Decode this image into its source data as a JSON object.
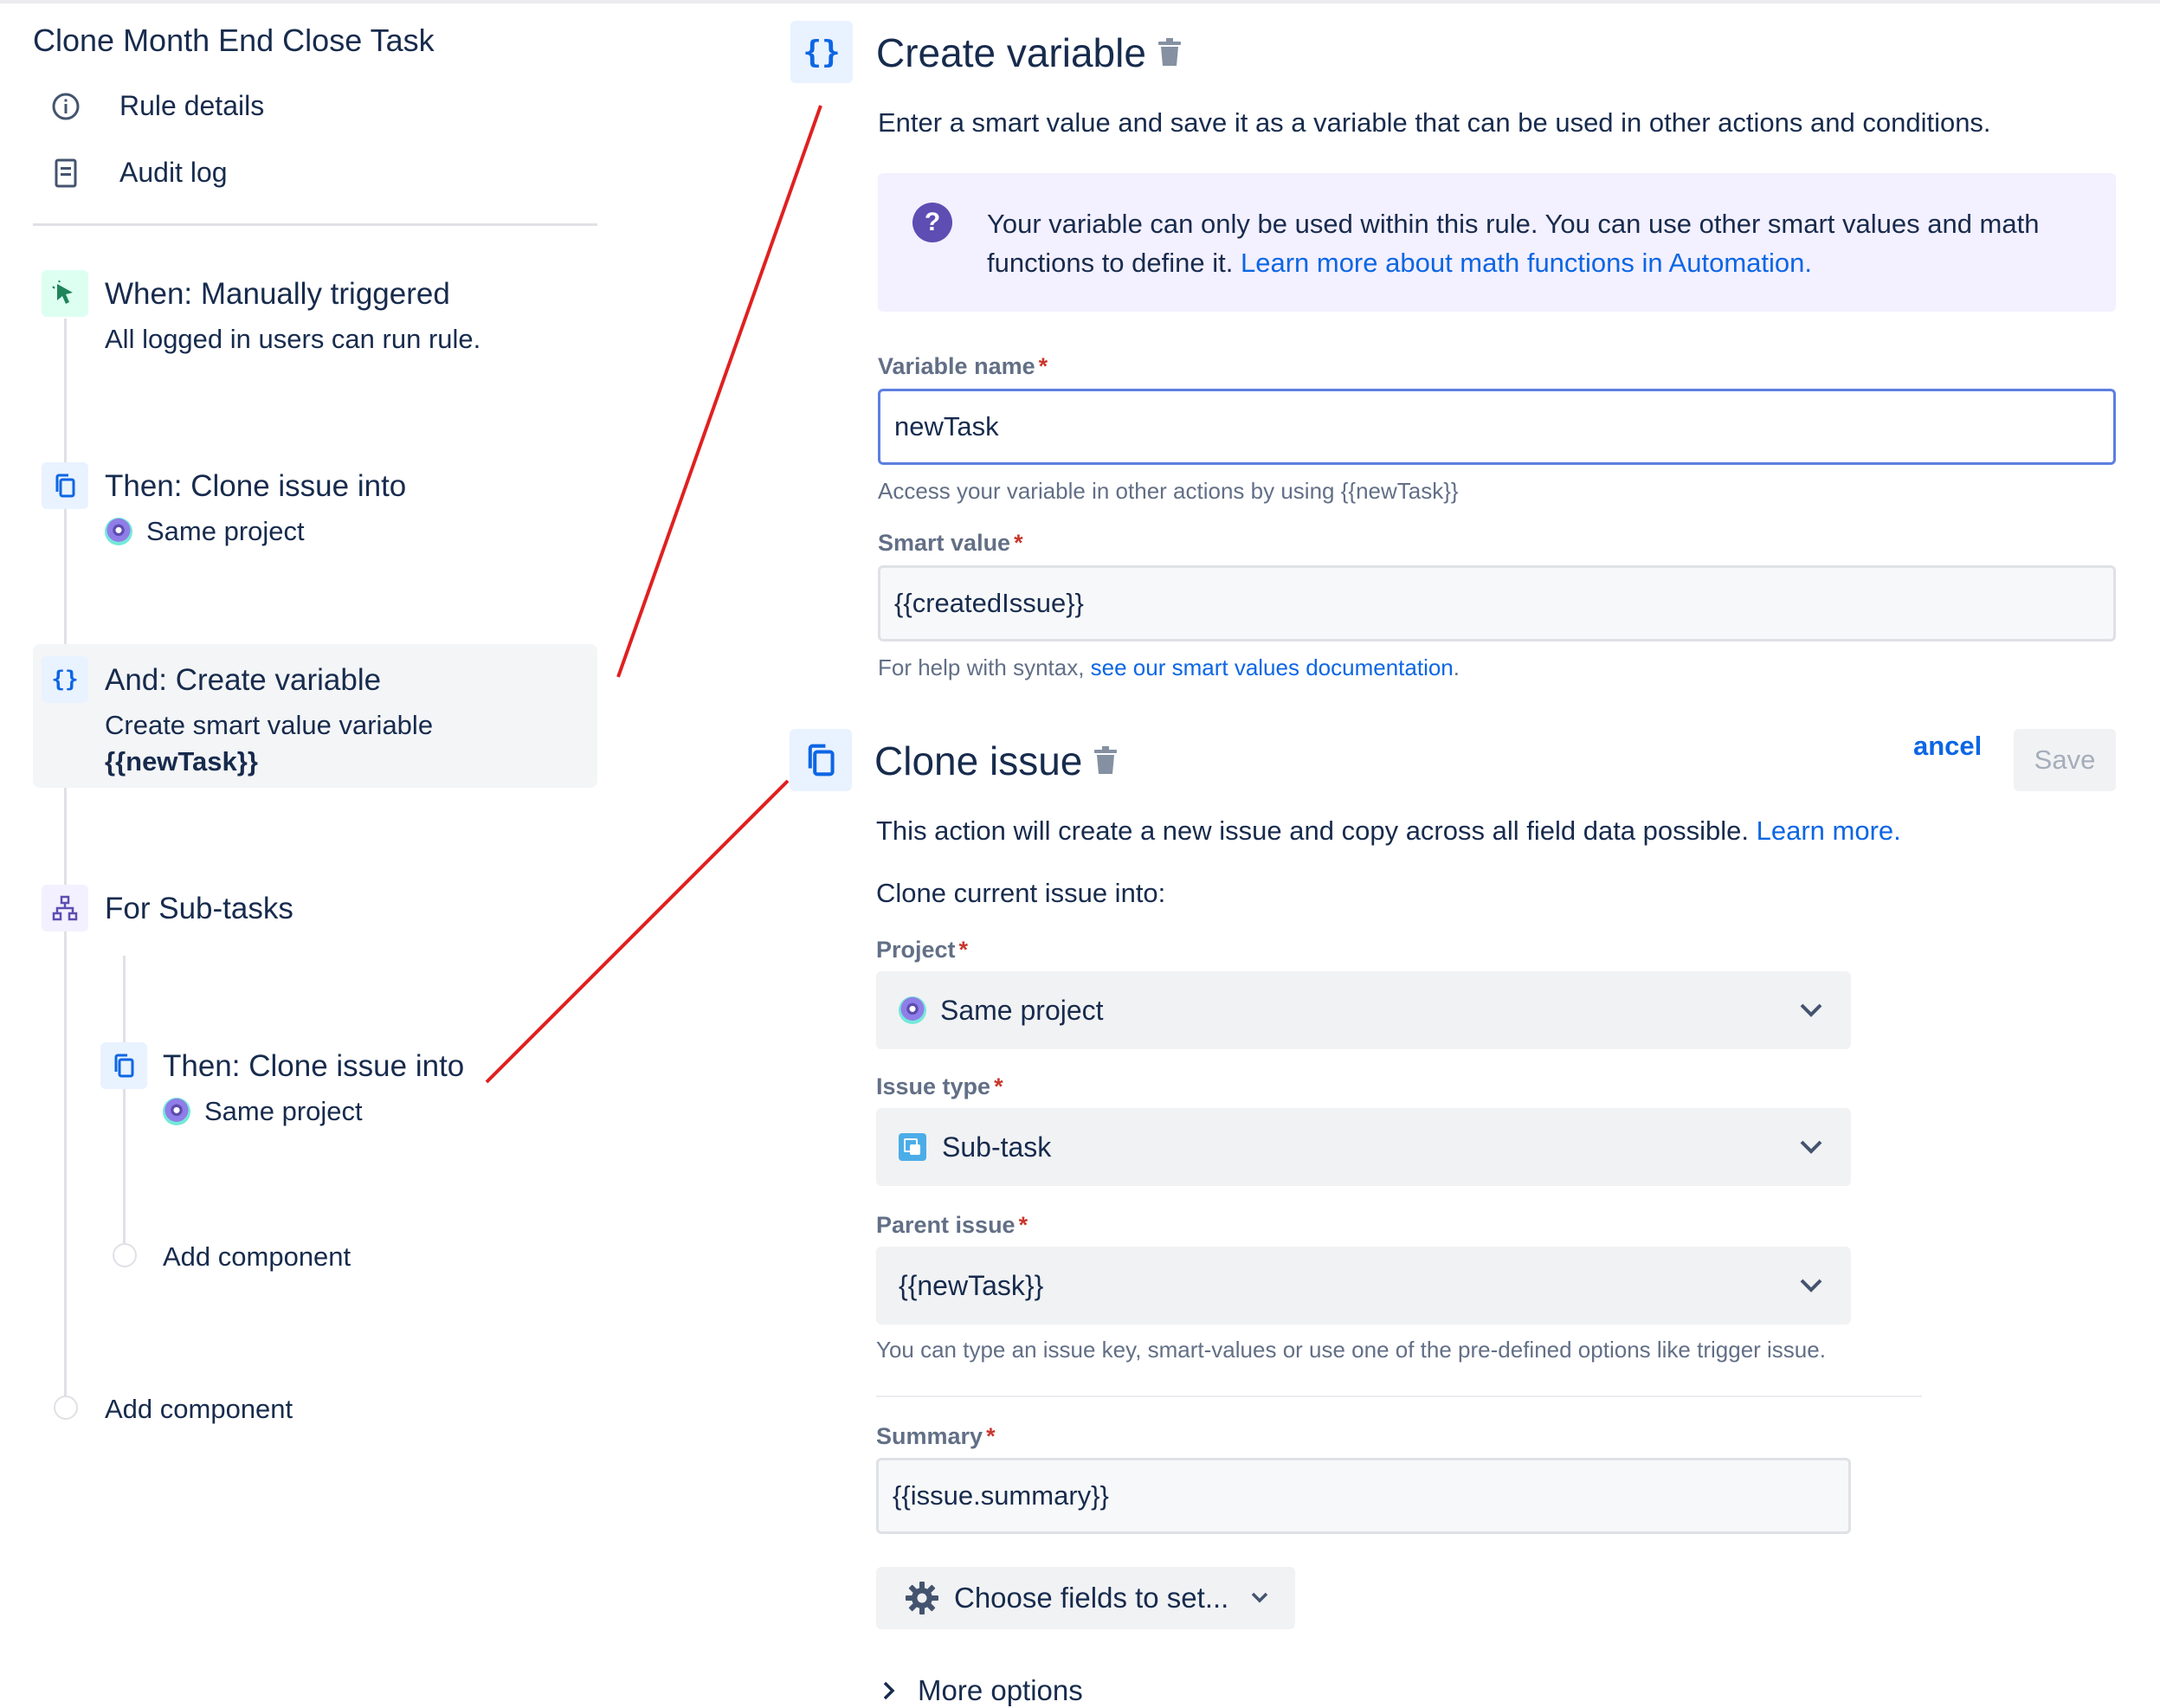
{
  "left_panel": {
    "rule_title": "Clone Month End Close Task",
    "nav": {
      "rule_details": "Rule details",
      "audit_log": "Audit log"
    },
    "components": {
      "trigger": {
        "title": "When: Manually triggered",
        "subtitle": "All logged in users can run rule.",
        "icon": "cursor-click-icon"
      },
      "clone1": {
        "title": "Then: Clone issue into",
        "project": "Same project",
        "icon": "copy-icon"
      },
      "create_variable": {
        "title": "And: Create variable",
        "subtitle": "Create smart value variable",
        "variable": "{{newTask}}",
        "icon": "braces-icon"
      },
      "branch": {
        "title": "For Sub-tasks",
        "icon": "branch-icon"
      },
      "clone2": {
        "title": "Then: Clone issue into",
        "project": "Same project",
        "icon": "copy-icon"
      },
      "add_component_inner": "Add component",
      "add_component_outer": "Add component"
    }
  },
  "create_variable_panel": {
    "title": "Create variable",
    "description": "Enter a smart value and save it as a variable that can be used in other actions and conditions.",
    "info": {
      "text": "Your variable can only be used within this rule. You can use other smart values and math functions to define it. ",
      "link": "Learn more about math functions in Automation.",
      "icon": "question-icon"
    },
    "variable_name": {
      "label": "Variable name",
      "value": "newTask",
      "help": "Access your variable in other actions by using {{newTask}}"
    },
    "smart_value": {
      "label": "Smart value",
      "value": "{{createdIssue}}",
      "help_prefix": "For help with syntax, ",
      "help_link": "see our smart values documentation",
      "help_suffix": "."
    }
  },
  "clone_issue_panel": {
    "title": "Clone issue",
    "cancel_label": "ancel",
    "save_label": "Save",
    "description": "This action will create a new issue and copy across all field data possible. ",
    "learn_more": "Learn more.",
    "clone_into_label": "Clone current issue into:",
    "project": {
      "label": "Project",
      "value": "Same project"
    },
    "issue_type": {
      "label": "Issue type",
      "value": "Sub-task"
    },
    "parent_issue": {
      "label": "Parent issue",
      "value": "{{newTask}}",
      "help": "You can type an issue key, smart-values or use one of the pre-defined options like trigger issue."
    },
    "summary": {
      "label": "Summary",
      "value": "{{issue.summary}}"
    },
    "choose_fields_label": "Choose fields to set...",
    "more_options_label": "More options"
  },
  "required_marker": "*",
  "colors": {
    "accent": "#0c66e4",
    "connector": "#e02020",
    "info_bg": "#f3f0ff",
    "focus_border": "#5c7fe0",
    "required": "#c9372c"
  }
}
